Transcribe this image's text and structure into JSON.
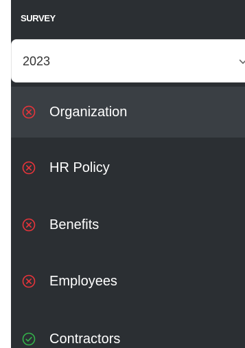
{
  "sidebar": {
    "section_title": "SURVEY",
    "year_select": {
      "value": "2023",
      "icon": "chevron-down-icon"
    },
    "items": [
      {
        "label": "Organization",
        "status": "incomplete",
        "icon": "error-circle-icon",
        "active": true
      },
      {
        "label": "HR Policy",
        "status": "incomplete",
        "icon": "error-circle-icon",
        "active": false
      },
      {
        "label": "Benefits",
        "status": "incomplete",
        "icon": "error-circle-icon",
        "active": false
      },
      {
        "label": "Employees",
        "status": "incomplete",
        "icon": "error-circle-icon",
        "active": false
      },
      {
        "label": "Contractors",
        "status": "complete",
        "icon": "check-circle-icon",
        "active": false
      }
    ]
  },
  "colors": {
    "sidebar_bg": "#2b2f33",
    "active_bg": "#3a3f44",
    "error": "#e8343a",
    "success": "#34b24a"
  }
}
